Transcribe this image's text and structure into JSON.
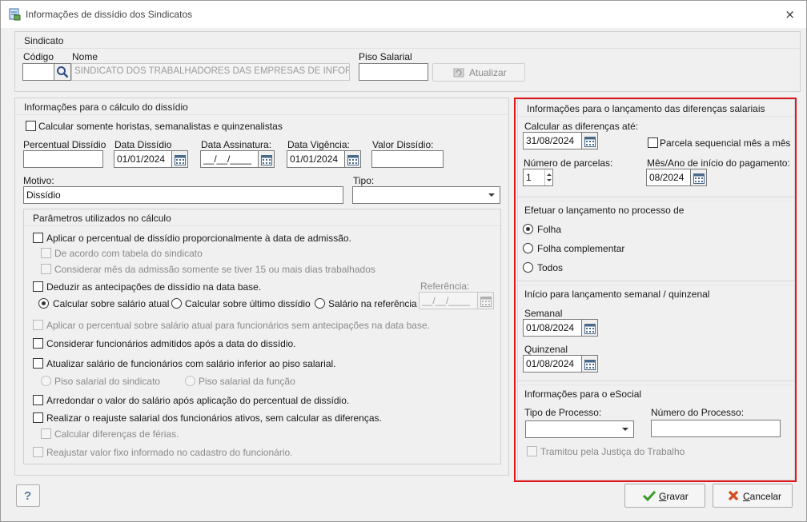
{
  "window": {
    "title": "Informações de dissídio dos Sindicatos",
    "close_glyph": "⨯"
  },
  "sindicato": {
    "title": "Sindicato",
    "codigo_label": "Código",
    "nome_label": "Nome",
    "nome_value": "SINDICATO DOS TRABALHADORES DAS EMPRESAS DE INFORMÁT",
    "piso_label": "Piso Salarial",
    "atualizar_label": "Atualizar"
  },
  "calculo": {
    "title": "Informações para o cálculo do dissídio",
    "somente_horistas_label": "Calcular somente horistas, semanalistas e quinzenalistas",
    "percentual_label": "Percentual Dissídio",
    "data_dissidio_label": "Data Dissídio",
    "data_dissidio_value": "01/01/2024",
    "data_assinatura_label": "Data Assinatura:",
    "data_assinatura_value": "__/__/____",
    "data_vigencia_label": "Data Vigência:",
    "data_vigencia_value": "01/01/2024",
    "valor_label": "Valor Dissídio:",
    "motivo_label": "Motivo:",
    "motivo_value": "Dissídio",
    "tipo_label": "Tipo:"
  },
  "parametros": {
    "title": "Parâmetros utilizados no cálculo",
    "aplicar_percentual": "Aplicar o percentual de dissídio proporcionalmente à data de admissão.",
    "de_acordo": "De acordo com tabela do sindicato",
    "considerar_mes": "Considerar mês da admissão somente se tiver 15 ou mais dias trabalhados",
    "deduzir": "Deduzir as antecipações de dissídio na data base.",
    "referencia_label": "Referência:",
    "referencia_value": "__/__/____",
    "calc_salario_atual": "Calcular sobre salário atual",
    "calc_ultimo_dissidio": "Calcular sobre último dissídio",
    "salario_referencia": "Salário na referência",
    "aplicar_sobre_atual": "Aplicar o percentual sobre salário atual para funcionários sem antecipações na data base.",
    "considerar_admitidos": "Considerar funcionários admitidos após a data do dissídio.",
    "atualizar_salario": "Atualizar salário de funcionários com salário inferior ao piso salarial.",
    "piso_sindicato": "Piso salarial do sindicato",
    "piso_funcao": "Piso salarial da função",
    "arredondar": "Arredondar o valor do salário após aplicação do percentual de dissídio.",
    "realizar_reajuste": "Realizar o reajuste salarial dos funcionários ativos, sem calcular as diferenças.",
    "calcular_ferias": "Calcular diferenças de férias.",
    "reajustar_fixo": "Reajustar valor fixo informado no cadastro do funcionário."
  },
  "lancamento": {
    "title": "Informações para o lançamento das diferenças salariais",
    "calcular_ate_label": "Calcular as diferenças até:",
    "calcular_ate_value": "31/08/2024",
    "parcela_seq_label": "Parcela sequencial mês a mês",
    "num_parcelas_label": "Número de parcelas:",
    "num_parcelas_value": "1",
    "mes_ano_label": "Mês/Ano de início do pagamento:",
    "mes_ano_value": "08/2024"
  },
  "efetuar": {
    "title": "Efetuar o lançamento no processo de",
    "folha": "Folha",
    "folha_complementar": "Folha complementar",
    "todos": "Todos"
  },
  "semanal": {
    "title": "Início para lançamento semanal / quinzenal",
    "semanal_label": "Semanal",
    "semanal_value": "01/08/2024",
    "quinzenal_label": "Quinzenal",
    "quinzenal_value": "01/08/2024"
  },
  "esocial": {
    "title": "Informações para o eSocial",
    "tipo_processo_label": "Tipo de Processo:",
    "numero_processo_label": "Número do Processo:",
    "tramitou_label": "Tramitou pela Justiça do Trabalho"
  },
  "footer": {
    "help_label": "?",
    "gravar_prefix": "G",
    "gravar_rest": "ravar",
    "cancelar_prefix": "C",
    "cancelar_rest": "ancelar"
  },
  "colors": {
    "highlight": "#e0161b",
    "check_green": "#3a9a2a",
    "cancel_red": "#d14b1e"
  }
}
